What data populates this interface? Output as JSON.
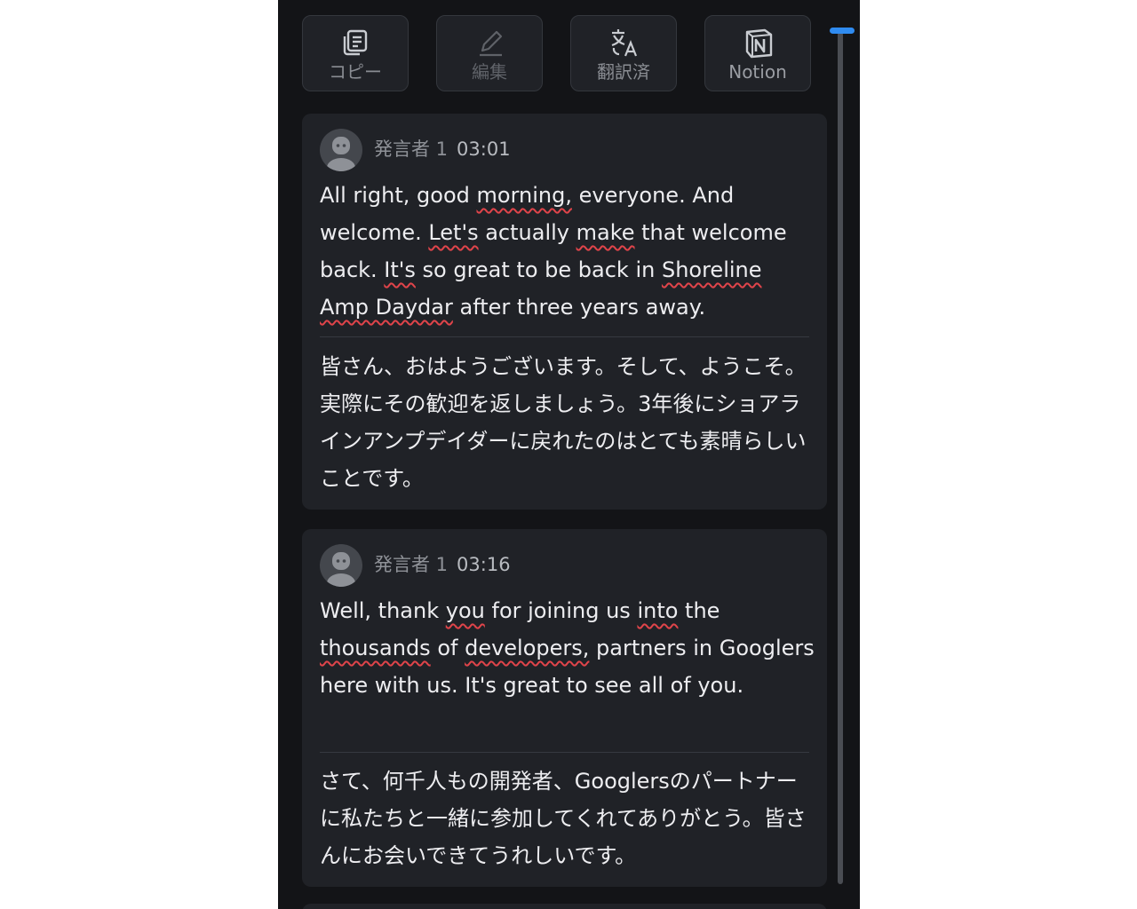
{
  "toolbar": {
    "copy": {
      "label": "コピー",
      "icon": "copy-icon"
    },
    "edit": {
      "label": "編集",
      "icon": "pencil-icon",
      "disabled": true
    },
    "translate": {
      "label": "翻訳済",
      "icon": "translate-icon"
    },
    "notion": {
      "label": "Notion",
      "icon": "notion-icon"
    }
  },
  "colors": {
    "panel_bg": "#131417",
    "card_bg": "#202227",
    "scroll_thumb": "#2f8bf0",
    "spell_underline": "#e0444a"
  },
  "entries": [
    {
      "speaker": "発言者 1",
      "time": "03:01",
      "segments": [
        {
          "text": "All right, good ",
          "misspelled": false
        },
        {
          "text": "morning,",
          "misspelled": true
        },
        {
          "text": " everyone. And welcome. ",
          "misspelled": false
        },
        {
          "text": "Let's",
          "misspelled": true
        },
        {
          "text": " actually ",
          "misspelled": false
        },
        {
          "text": "make",
          "misspelled": true
        },
        {
          "text": " that welcome back. ",
          "misspelled": false
        },
        {
          "text": "It's",
          "misspelled": true
        },
        {
          "text": " so great to be back in ",
          "misspelled": false
        },
        {
          "text": "Shoreline Amp Daydar",
          "misspelled": true
        },
        {
          "text": " after three years away.",
          "misspelled": false
        }
      ],
      "translation": "皆さん、おはようございます。そして、ようこそ。実際にその歓迎を返しましょう。3年後にショアラインアンプデイダーに戻れたのはとても素晴らしいことです。"
    },
    {
      "speaker": "発言者 1",
      "time": "03:16",
      "segments": [
        {
          "text": "Well, thank ",
          "misspelled": false
        },
        {
          "text": "you",
          "misspelled": true
        },
        {
          "text": " for joining us ",
          "misspelled": false
        },
        {
          "text": "into",
          "misspelled": true
        },
        {
          "text": " the ",
          "misspelled": false
        },
        {
          "text": "thousands",
          "misspelled": true
        },
        {
          "text": " of ",
          "misspelled": false
        },
        {
          "text": "developers,",
          "misspelled": true
        },
        {
          "text": " partners in Googlers here with us. It's great to see all of you.",
          "misspelled": false
        }
      ],
      "translation": "さて、何千人もの開発者、Googlersのパートナーに私たちと一緒に参加してくれてありがとう。皆さんにお会いできてうれしいです。"
    }
  ]
}
